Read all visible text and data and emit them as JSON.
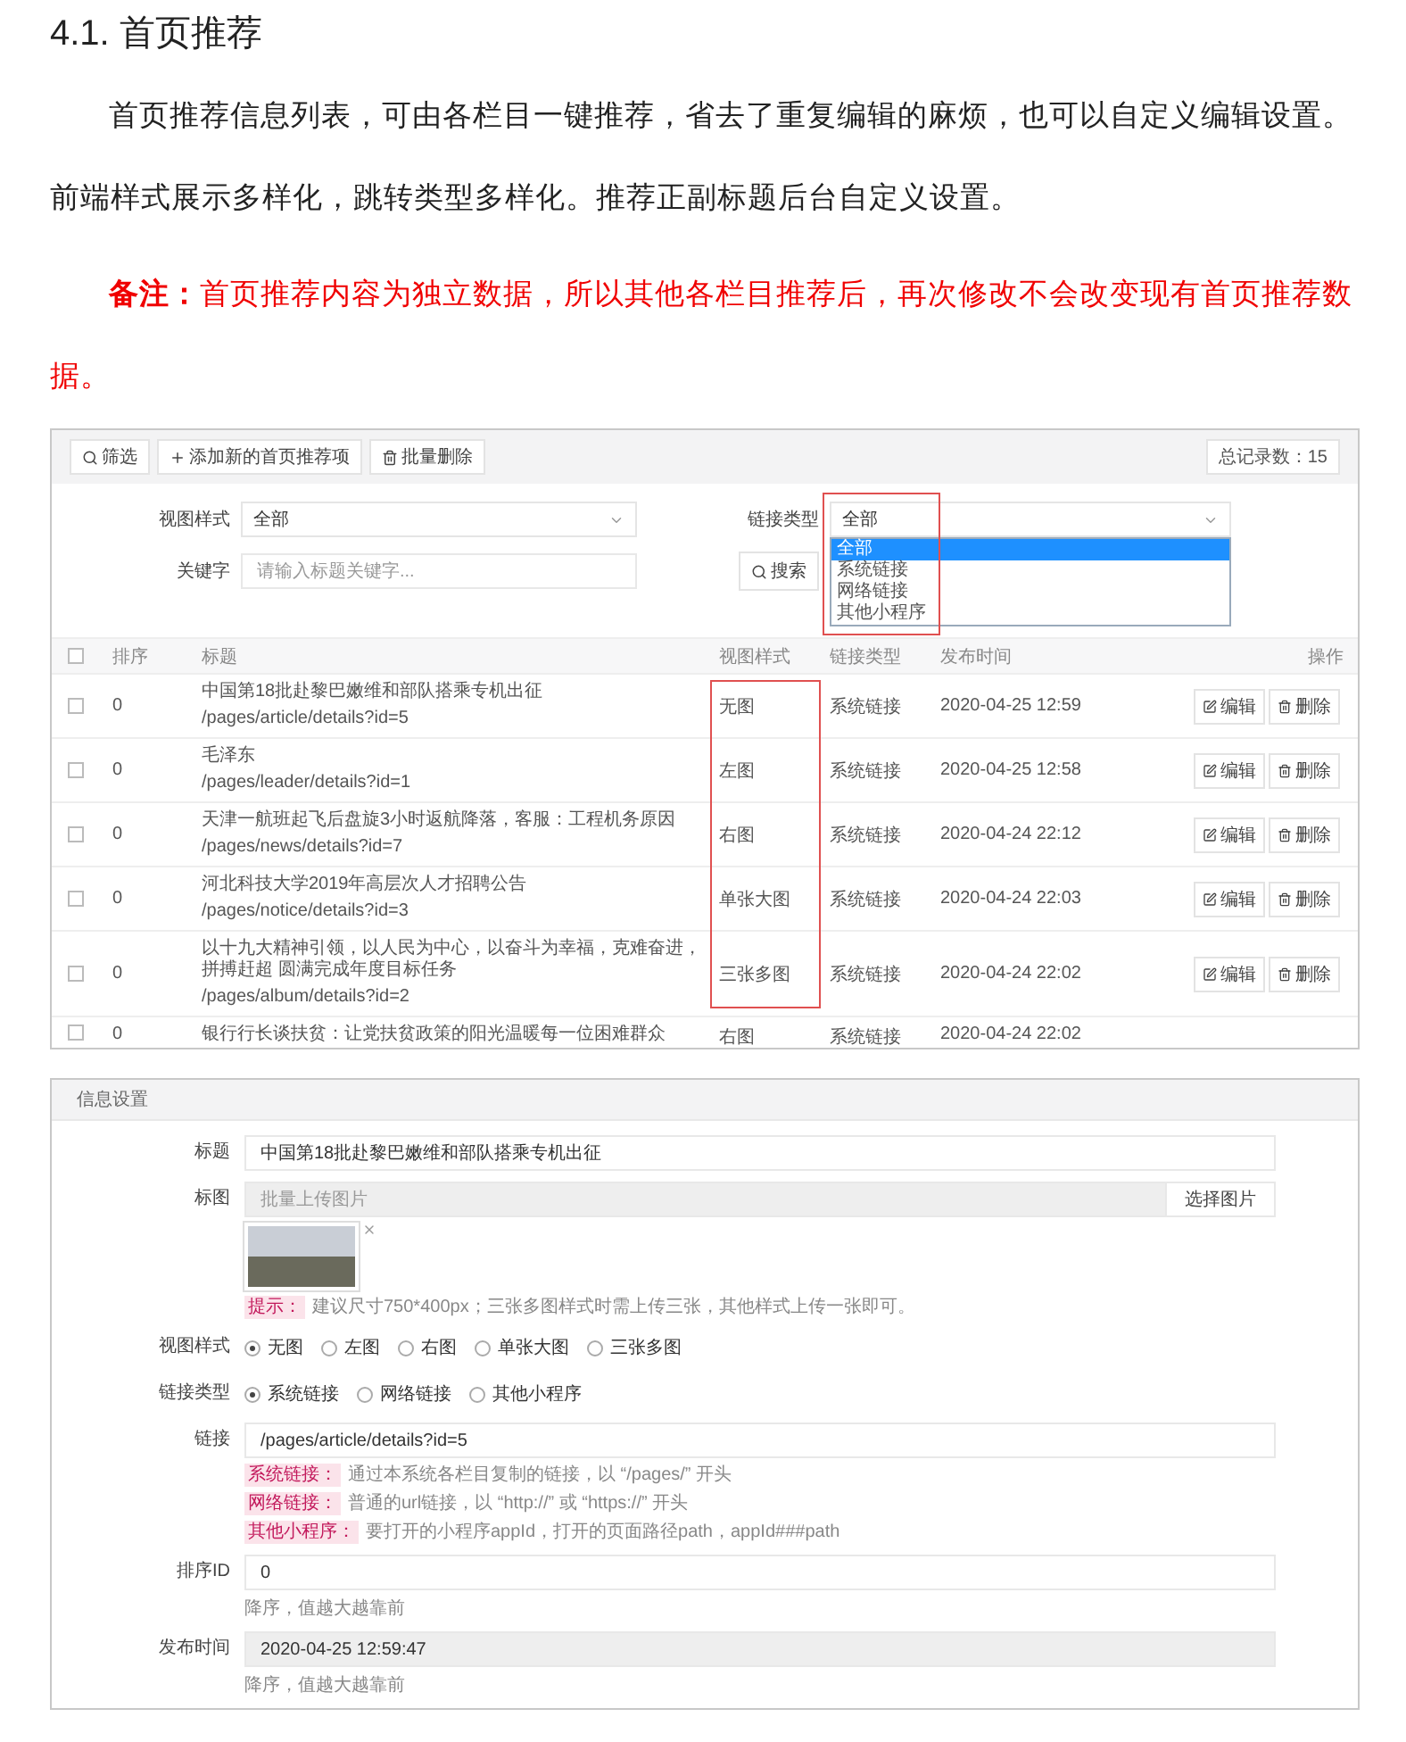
{
  "heading": "4.1. 首页推荐",
  "paragraphs": [
    {
      "kind": "normal",
      "text": "首页推荐信息列表，可由各栏目一键推荐，省去了重复编辑的麻烦，也可以自定义编辑设置。前端样式展示多样化，跳转类型多样化。推荐正副标题后台自定义设置。"
    },
    {
      "kind": "note",
      "text": "**备注：**首页推荐内容为独立数据，所以其他各栏目推荐后，再次修改不会改变现有首页推荐数据。"
    }
  ],
  "list_screen": {
    "toolbar": {
      "buttons": [
        {
          "kind": "filter",
          "label": "筛选"
        },
        {
          "kind": "add",
          "label": "添加新的首页推荐项"
        },
        {
          "kind": "delete",
          "label": "批量删除"
        }
      ],
      "total": "总记录数：15"
    },
    "filters": {
      "view_style": {
        "label": "视图样式",
        "value": "全部"
      },
      "link_type": {
        "label": "链接类型",
        "value": "全部",
        "options": [
          {
            "label": "全部",
            "selected": true
          },
          {
            "label": "系统链接",
            "selected": false
          },
          {
            "label": "网络链接",
            "selected": false
          },
          {
            "label": "其他小程序",
            "selected": false
          }
        ]
      },
      "keyword": {
        "label": "关键字",
        "placeholder": "请输入标题关键字..."
      },
      "search_button": "搜索"
    },
    "table": {
      "checked": false,
      "columns": [
        "排序",
        "标题",
        "视图样式",
        "链接类型",
        "发布时间",
        "操作"
      ],
      "rows": [
        {
          "checked": false,
          "sort": "0",
          "title": "中国第18批赴黎巴嫩维和部队搭乘专机出征",
          "path": "/pages/article/details?id=5",
          "view_style": "无图",
          "link_type": "系统链接",
          "time": "2020-04-25 12:59",
          "actions": [
            "编辑",
            "删除"
          ]
        },
        {
          "checked": false,
          "sort": "0",
          "title": "毛泽东",
          "path": "/pages/leader/details?id=1",
          "view_style": "左图",
          "link_type": "系统链接",
          "time": "2020-04-25 12:58",
          "actions": [
            "编辑",
            "删除"
          ]
        },
        {
          "checked": false,
          "sort": "0",
          "title": "天津一航班起飞后盘旋3小时返航降落，客服：工程机务原因",
          "path": "/pages/news/details?id=7",
          "view_style": "右图",
          "link_type": "系统链接",
          "time": "2020-04-24 22:12",
          "actions": [
            "编辑",
            "删除"
          ]
        },
        {
          "checked": false,
          "sort": "0",
          "title": "河北科技大学2019年高层次人才招聘公告",
          "path": "/pages/notice/details?id=3",
          "view_style": "单张大图",
          "link_type": "系统链接",
          "time": "2020-04-24 22:03",
          "actions": [
            "编辑",
            "删除"
          ]
        },
        {
          "checked": false,
          "sort": "0",
          "title": "以十九大精神引领，以人民为中心，以奋斗为幸福，克难奋进，拼搏赶超 圆满完成年度目标任务",
          "path": "/pages/album/details?id=2",
          "view_style": "三张多图",
          "link_type": "系统链接",
          "time": "2020-04-24 22:02",
          "actions": [
            "编辑",
            "删除"
          ]
        }
      ],
      "partial_row": {
        "checked": false,
        "sort": "0",
        "title": "银行行长谈扶贫：让党扶贫政策的阳光温暖每一位困难群众",
        "view_style": "右图",
        "link_type": "系统链接",
        "time": "2020-04-24 22:02"
      }
    }
  },
  "form_screen": {
    "header": "信息设置",
    "title_field": {
      "label": "标题",
      "value": "中国第18批赴黎巴嫩维和部队搭乘专机出征"
    },
    "cover_field": {
      "label": "标图",
      "placeholder": "批量上传图片",
      "button": "选择图片",
      "hint": {
        "tag": "提示：",
        "text": "建议尺寸750*400px；三张多图样式时需上传三张，其他样式上传一张即可。"
      }
    },
    "view_style": {
      "label": "视图样式",
      "options": [
        {
          "label": "无图",
          "selected": true
        },
        {
          "label": "左图",
          "selected": false
        },
        {
          "label": "右图",
          "selected": false
        },
        {
          "label": "单张大图",
          "selected": false
        },
        {
          "label": "三张多图",
          "selected": false
        }
      ]
    },
    "link_type": {
      "label": "链接类型",
      "options": [
        {
          "label": "系统链接",
          "selected": true
        },
        {
          "label": "网络链接",
          "selected": false
        },
        {
          "label": "其他小程序",
          "selected": false
        }
      ]
    },
    "link_field": {
      "label": "链接",
      "value": "/pages/article/details?id=5",
      "hints": [
        {
          "tag": "系统链接：",
          "text": "通过本系统各栏目复制的链接，以 “/pages/” 开头"
        },
        {
          "tag": "网络链接：",
          "text": "普通的url链接，以 “http://” 或 “https://” 开头"
        },
        {
          "tag": "其他小程序：",
          "text": "要打开的小程序appId，打开的页面路径path，appId###path"
        }
      ]
    },
    "sort_field": {
      "label": "排序ID",
      "value": "0",
      "note": "降序，值越大越靠前"
    },
    "time_field": {
      "label": "发布时间",
      "value": "2020-04-25 12:59:47",
      "disabled": true,
      "note": "降序，值越大越靠前"
    }
  }
}
